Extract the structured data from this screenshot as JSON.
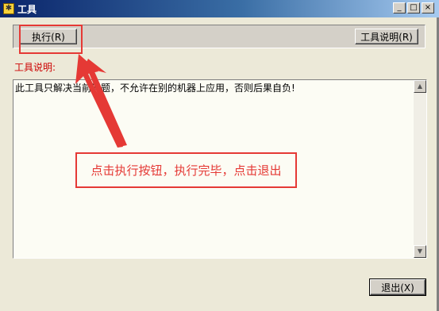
{
  "window": {
    "title": "工具",
    "icon": "app-icon",
    "controls": {
      "minimize": "_",
      "maximize": "□",
      "close": "×"
    }
  },
  "toolbar": {
    "run_label": "执行(R)",
    "help_label": "工具说明(R)"
  },
  "description": {
    "label": "工具说明:",
    "text": "此工具只解决当前问题，不允许在别的机器上应用，否则后果自负!"
  },
  "annotation": {
    "text": "点击执行按钮，执行完毕，点击退出",
    "color": "#e53935"
  },
  "footer": {
    "exit_label": "退出(X)"
  }
}
